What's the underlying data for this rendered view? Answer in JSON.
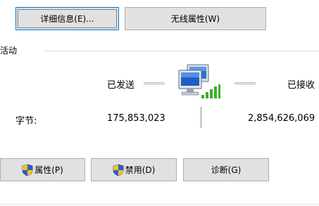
{
  "buttons": {
    "details": "详细信息(E)...",
    "wireless_properties": "无线属性(W)",
    "properties": "属性(P)",
    "disable": "禁用(D)",
    "diagnose": "诊断(G)"
  },
  "activity": {
    "group_label": "活动",
    "sent_label": "已发送",
    "received_label": "已接收",
    "bytes_label": "字节:",
    "bytes_sent": "175,853,023",
    "bytes_received": "2,854,626,069"
  },
  "icons": {
    "network": "network-computers-icon",
    "signal": "wireless-signal-icon",
    "uac_shield": "uac-shield-icon"
  },
  "colors": {
    "button_bg": "#e1e1e1",
    "button_border": "#adadad",
    "focus_border": "#0078d7",
    "signal_green": "#3fae2a"
  }
}
